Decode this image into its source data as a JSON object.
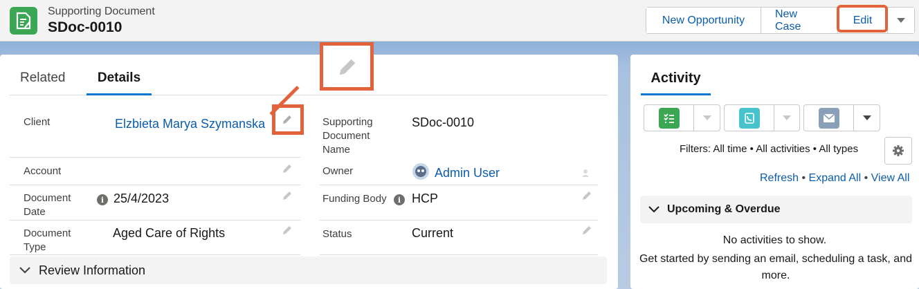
{
  "header": {
    "object_type": "Supporting Document",
    "record_name": "SDoc-0010",
    "buttons": {
      "new_opportunity": "New Opportunity",
      "new_case": "New Case",
      "edit": "Edit"
    }
  },
  "tabs": {
    "related": "Related",
    "details": "Details"
  },
  "fields": {
    "client": {
      "label": "Client",
      "value": "Elzbieta Marya Szymanska"
    },
    "supporting_document_name": {
      "label": "Supporting Document Name",
      "value": "SDoc-0010"
    },
    "account": {
      "label": "Account",
      "value": ""
    },
    "owner": {
      "label": "Owner",
      "value": "Admin User"
    },
    "document_date": {
      "label": "Document Date",
      "value": "25/4/2023"
    },
    "funding_body": {
      "label": "Funding Body",
      "value": "HCP"
    },
    "document_type": {
      "label": "Document Type",
      "value": "Aged Care of Rights"
    },
    "status": {
      "label": "Status",
      "value": "Current"
    }
  },
  "sections": {
    "review_information": "Review Information"
  },
  "activity": {
    "tab": "Activity",
    "filters": "Filters: All time • All activities • All types",
    "links": {
      "refresh": "Refresh",
      "expand_all": "Expand All",
      "view_all": "View All"
    },
    "upcoming": "Upcoming & Overdue",
    "empty_title": "No activities to show.",
    "empty_message": "Get started by sending an email, scheduling a task, and more."
  },
  "colors": {
    "accent": "#0176d3",
    "link": "#0b5cab",
    "annotation": "#e2633b",
    "object_icon": "#3ba755",
    "task_icon": "#3ba755",
    "call_icon": "#48c3cc",
    "email_icon": "#8a9fb8"
  }
}
